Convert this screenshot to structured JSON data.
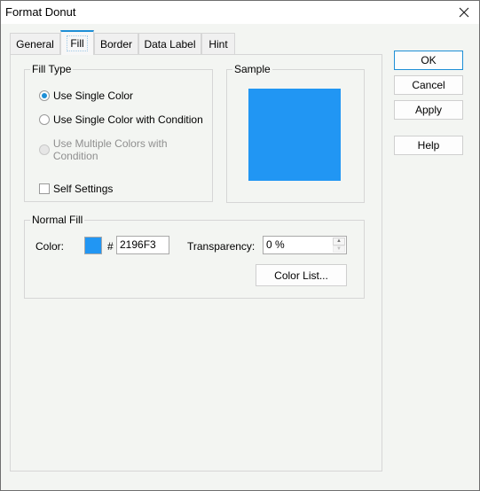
{
  "window": {
    "title": "Format Donut",
    "close_label": "Close"
  },
  "tabs": [
    {
      "label": "General",
      "active": false
    },
    {
      "label": "Fill",
      "active": true
    },
    {
      "label": "Border",
      "active": false
    },
    {
      "label": "Data Label",
      "active": false
    },
    {
      "label": "Hint",
      "active": false
    }
  ],
  "fill_type": {
    "label": "Fill Type",
    "options": [
      {
        "label": "Use Single Color",
        "checked": true,
        "enabled": true
      },
      {
        "label": "Use Single Color with Condition",
        "checked": false,
        "enabled": true
      },
      {
        "label": "Use Multiple Colors with Condition",
        "checked": false,
        "enabled": false
      }
    ],
    "self_settings": {
      "label": "Self Settings",
      "checked": false
    }
  },
  "sample": {
    "label": "Sample",
    "color": "#2196F3"
  },
  "normal_fill": {
    "label": "Normal Fill",
    "color_label": "Color:",
    "color_swatch": "#2196F3",
    "hash": "#",
    "color_hex": "2196F3",
    "transparency_label": "Transparency:",
    "transparency_value": "0 %",
    "color_list_button": "Color List..."
  },
  "buttons": {
    "ok": "OK",
    "cancel": "Cancel",
    "apply": "Apply",
    "help": "Help"
  },
  "colors": {
    "accent": "#1E8FD6"
  }
}
